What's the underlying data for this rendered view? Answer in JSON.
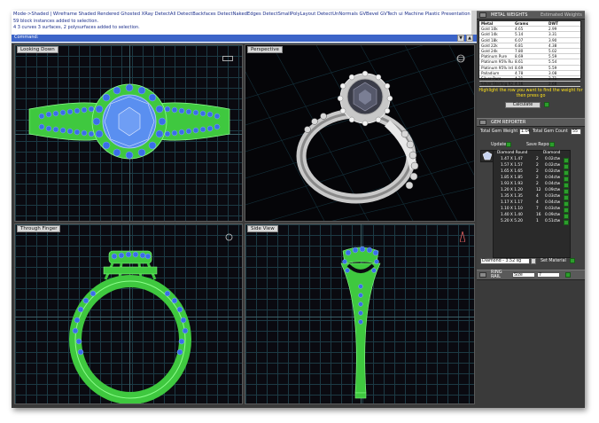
{
  "command": {
    "menu": "Mode->Shaded | Wireframe Shaded Rendered Ghosted XRay DetectAll DetectBackfaces DetectNakedEdges DetectSmallPolyLayout DetectUnNormals GVBevel GVTech ui Machine Plastic Presentation Ste",
    "lines": [
      "59 block instances added to selection.",
      "4 3 curves 3 surfaces, 2 polysurfaces added to selection."
    ],
    "prompt": "Command:",
    "ctrl_down": "▼",
    "ctrl_up": "▲"
  },
  "viewports": [
    {
      "label": "Looking Down"
    },
    {
      "label": "Perspective"
    },
    {
      "label": "Through Finger"
    },
    {
      "label": "Side View"
    }
  ],
  "panel": {
    "metal": {
      "title": "METAL WEIGHTS",
      "title_right": "Estimated Weights",
      "headers": [
        "Metal",
        "Grams",
        "DWT"
      ],
      "rows": [
        [
          "Gold 10k",
          "4.65",
          "2.99"
        ],
        [
          "Gold 14k",
          "5.14",
          "3.31"
        ],
        [
          "Gold 18k",
          "6.07",
          "3.90"
        ],
        [
          "Gold 22k",
          "6.81",
          "4.38"
        ],
        [
          "Gold 24k",
          "7.80",
          "5.02"
        ],
        [
          "Platinum Pure",
          "8.69",
          "5.59"
        ],
        [
          "Platinum 95% Ru",
          "8.61",
          "5.54"
        ],
        [
          "Platinum 95% Ird",
          "8.69",
          "5.59"
        ],
        [
          "Palladium",
          "4.78",
          "3.08"
        ],
        [
          "Silver Pure",
          "4.21",
          "2.71"
        ],
        [
          "Silver Sterling 925",
          "4.16",
          "2.68"
        ]
      ],
      "note": "Highlight the row you want to find the weight for then press go",
      "calc_label": "Calculate"
    },
    "gem": {
      "title": "GEM REPORTER",
      "total_weight_label": "Total Gem Weight",
      "total_weight_value": "1.04",
      "total_count_label": "Total Gem Count",
      "total_count_value": "55",
      "update_label": "Update",
      "save_label": "Save Report",
      "col_headers": [
        "Diamond Round",
        "",
        "Diamond"
      ],
      "rows": [
        [
          "1.47 X 1.47",
          "2",
          "0.02ctw"
        ],
        [
          "1.57 X 1.57",
          "2",
          "0.02ctw"
        ],
        [
          "1.65 X 1.65",
          "2",
          "0.02ctw"
        ],
        [
          "1.85 X 1.85",
          "2",
          "0.04ctw"
        ],
        [
          "1.93 X 1.93",
          "2",
          "0.04ctw"
        ],
        [
          "1.20 X 1.20",
          "12",
          "0.09ctw"
        ],
        [
          "1.35 X 1.35",
          "4",
          "0.03ctw"
        ],
        [
          "1.17 X 1.17",
          "4",
          "0.04ctw"
        ],
        [
          "1.10 X 1.10",
          "7",
          "0.03ctw"
        ],
        [
          "1.40 X 1.40",
          "16",
          "0.09ctw"
        ],
        [
          "5.20 X 5.20",
          "1",
          "0.51ctw"
        ]
      ],
      "material_select": "Diamond - 3.52 sg",
      "set_material_label": "Set Material"
    },
    "ringrail": {
      "title_line1": "RING",
      "title_line2": "RAIL",
      "select1": "Size",
      "select2": "7"
    }
  }
}
